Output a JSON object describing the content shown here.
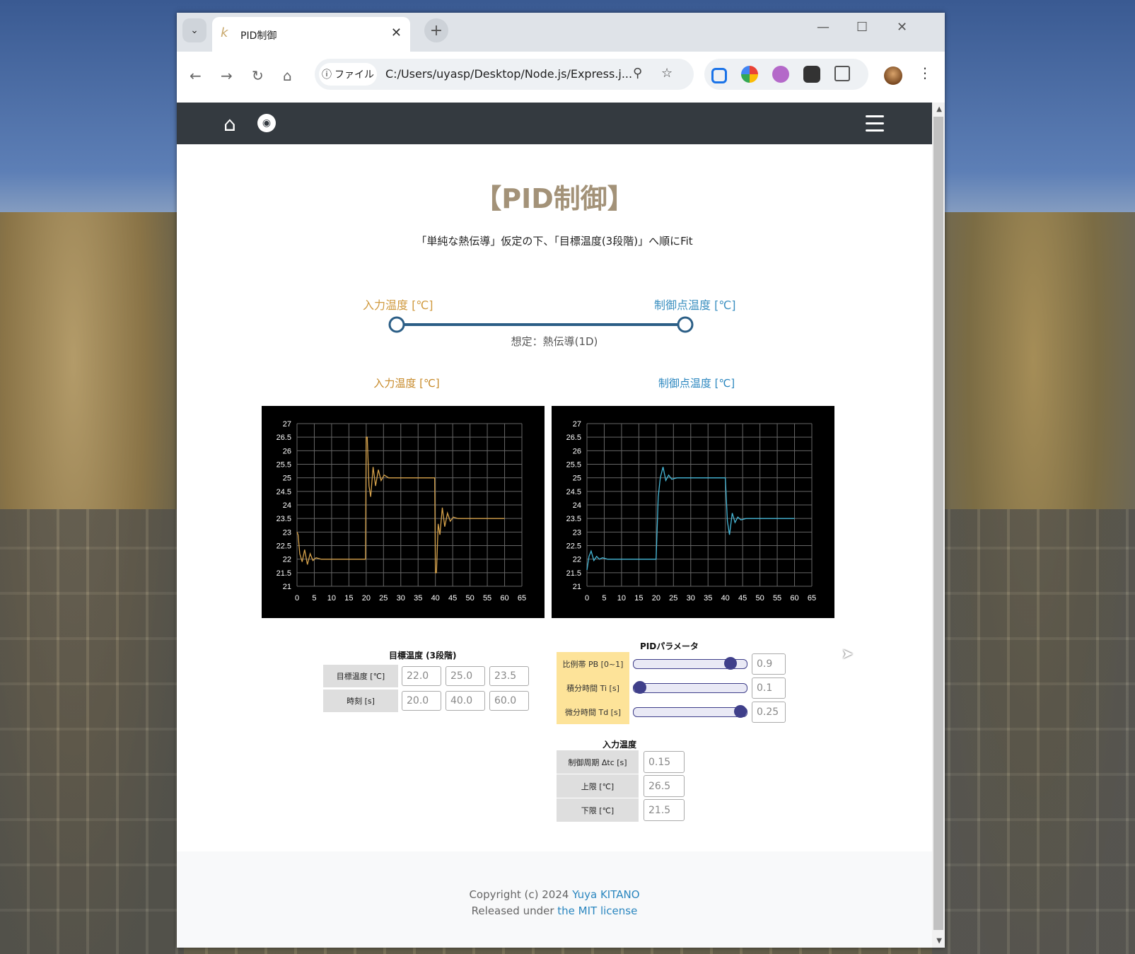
{
  "browser": {
    "tab_title": "PID制御",
    "tab_favicon": "k",
    "site_chip": "ファイル",
    "url": "C:/Users/uyasp/Desktop/Node.js/Express.j..."
  },
  "page": {
    "title": "【PID制御】",
    "subtitle": "「単純な熱伝導」仮定の下、「目標温度(3段階)」へ順にFit",
    "model_label_in": "入力温度 [℃]",
    "model_label_out": "制御点温度 [℃]",
    "model_caption": "想定：熱伝導(1D)",
    "colors": {
      "in": "#d6a24b",
      "out": "#46b8d8",
      "title": "#a39278",
      "slider": "#3f3f8a"
    }
  },
  "chart_data": [
    {
      "type": "line",
      "title": "入力温度 [℃]",
      "ylim": [
        21,
        27
      ],
      "xlim": [
        0,
        65
      ],
      "yticks": [
        "27",
        "26.5",
        "26",
        "25.5",
        "25",
        "24.5",
        "24",
        "23.5",
        "23",
        "22.5",
        "22",
        "21.5",
        "21"
      ],
      "xticks": [
        "0",
        "5",
        "10",
        "15",
        "20",
        "25",
        "30",
        "35",
        "40",
        "45",
        "50",
        "55",
        "60",
        "65"
      ],
      "grid": true,
      "series": [
        {
          "x": [
            0,
            0.3,
            0.8,
            1.5,
            2.2,
            3,
            3.8,
            4.6,
            5.5,
            7,
            10,
            15,
            19.8,
            20,
            20.3,
            20.8,
            21.3,
            22,
            22.7,
            23.5,
            24.3,
            25.2,
            26.5,
            28,
            30,
            35,
            39.8,
            40,
            40.3,
            40.8,
            41.3,
            42,
            42.7,
            43.5,
            44.3,
            45.2,
            46.5,
            48,
            50,
            55,
            60
          ],
          "y": [
            23.0,
            22.9,
            22.2,
            21.9,
            22.35,
            21.8,
            22.2,
            21.95,
            22.05,
            22.0,
            22.0,
            22.0,
            22.0,
            26.5,
            26.5,
            24.7,
            24.3,
            25.4,
            24.7,
            25.3,
            24.9,
            25.1,
            25.0,
            25.0,
            25.0,
            25.0,
            25.0,
            21.5,
            21.5,
            23.3,
            22.9,
            23.9,
            23.2,
            23.7,
            23.4,
            23.55,
            23.5,
            23.5,
            23.5,
            23.5,
            23.5
          ]
        }
      ]
    },
    {
      "type": "line",
      "title": "制御点温度 [℃]",
      "ylim": [
        21,
        27
      ],
      "xlim": [
        0,
        65
      ],
      "yticks": [
        "27",
        "26.5",
        "26",
        "25.5",
        "25",
        "24.5",
        "24",
        "23.5",
        "23",
        "22.5",
        "22",
        "21.5",
        "21"
      ],
      "xticks": [
        "0",
        "5",
        "10",
        "15",
        "20",
        "25",
        "30",
        "35",
        "40",
        "45",
        "50",
        "55",
        "60",
        "65"
      ],
      "grid": true,
      "series": [
        {
          "x": [
            0,
            0.6,
            1.2,
            2,
            2.8,
            3.6,
            4.5,
            6,
            10,
            15,
            19.8,
            20,
            20.6,
            21.2,
            22,
            22.8,
            23.6,
            24.5,
            26,
            30,
            35,
            39.8,
            40,
            40.6,
            41.2,
            42,
            42.8,
            43.6,
            44.5,
            46,
            50,
            55,
            60
          ],
          "y": [
            21.6,
            22.1,
            22.3,
            21.95,
            22.1,
            22.0,
            22.05,
            22.0,
            22.0,
            22.0,
            22.0,
            22.0,
            24.3,
            25.0,
            25.4,
            24.9,
            25.1,
            24.95,
            25.0,
            25.0,
            25.0,
            25.0,
            25.0,
            23.4,
            22.9,
            23.7,
            23.35,
            23.55,
            23.45,
            23.5,
            23.5,
            23.5,
            23.5
          ]
        }
      ]
    }
  ],
  "target": {
    "title": "目標温度 (3段階)",
    "row1_label": "目標温度 [℃]",
    "row1": [
      "22.0",
      "25.0",
      "23.5"
    ],
    "row2_label": "時刻 [s]",
    "row2": [
      "20.0",
      "40.0",
      "60.0"
    ]
  },
  "pid": {
    "title": "PIDパラメータ",
    "params": [
      {
        "label": "比例帯 PB [0~1]",
        "value": "0.9",
        "level": 0.9
      },
      {
        "label": "積分時間 Ti [s]",
        "value": "0.1",
        "level": 0.0
      },
      {
        "label": "微分時間 Td [s]",
        "value": "0.25",
        "level": 1.0
      }
    ]
  },
  "input_temp": {
    "title": "入力温度",
    "rows": [
      {
        "label": "制御周期 Δtc [s]",
        "value": "0.15"
      },
      {
        "label": "上限 [℃]",
        "value": "26.5"
      },
      {
        "label": "下限 [℃]",
        "value": "21.5"
      }
    ]
  },
  "footer": {
    "copyright_prefix": "Copyright (c) 2024 ",
    "author": "Yuya KITANO",
    "license_prefix": "Released under ",
    "license_link": "the MIT license"
  }
}
